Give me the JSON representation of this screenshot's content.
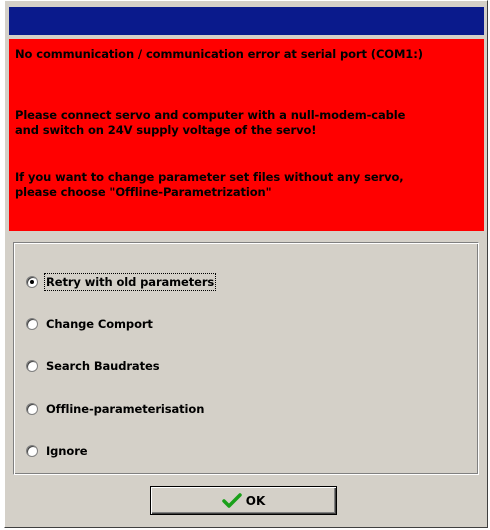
{
  "dialog": {
    "title": ""
  },
  "error": {
    "line1": "No communication / communication error at serial port (COM1:)",
    "line2": "Please connect servo and computer with a null-modem-cable",
    "line3": "and switch on 24V supply voltage of the servo!",
    "line4": "If you want to change parameter set files without any servo,",
    "line5": "please choose \"Offline-Parametrization\""
  },
  "options": [
    {
      "label": "Retry with old parameters",
      "selected": true
    },
    {
      "label": "Change Comport",
      "selected": false
    },
    {
      "label": "Search Baudrates",
      "selected": false
    },
    {
      "label": "Offline-parameterisation",
      "selected": false
    },
    {
      "label": "Ignore",
      "selected": false
    }
  ],
  "ok_button": {
    "label": "OK",
    "icon": "checkmark-icon"
  },
  "colors": {
    "titlebar": "#0a1a8c",
    "error_background": "#ff0000",
    "dialog_background": "#d4d0c8",
    "checkmark": "#1aa01a"
  }
}
